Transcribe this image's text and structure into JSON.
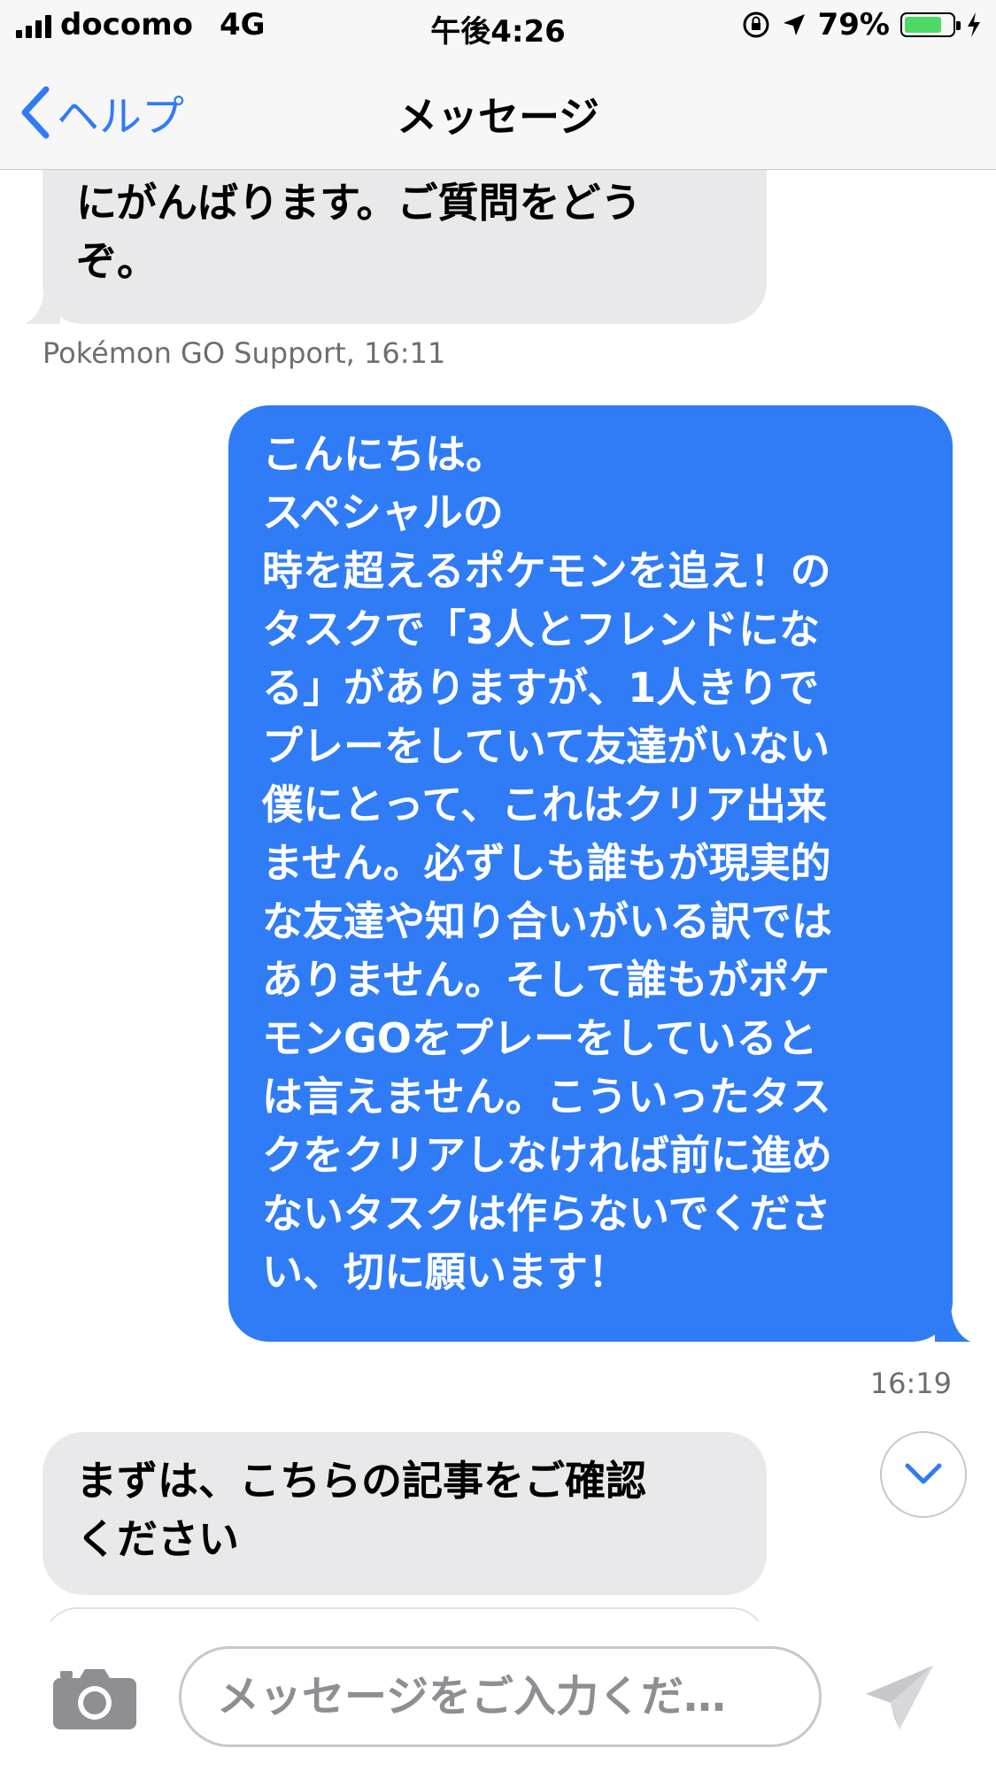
{
  "status_bar": {
    "carrier": "docomo",
    "network": "4G",
    "time": "午後4:26",
    "battery_percent": "79%",
    "battery_level": 0.79,
    "battery_color": "#4cd964"
  },
  "nav": {
    "back_label": "ヘルプ",
    "title": "メッセージ"
  },
  "messages": {
    "first_incoming": {
      "lines": [
        "にがんばります。ご質問をどう",
        "ぞ。"
      ],
      "sender_time": "Pokémon GO Support, 16:11"
    },
    "outgoing": {
      "lines": [
        "こんにちは。",
        "スペシャルの",
        "時を超えるポケモンを追え！の",
        "タスクで「3人とフレンドにな",
        "る」がありますが、1人きりで",
        "プレーをしていて友達がいない",
        "僕にとって、これはクリア出来",
        "ません。必ずしも誰もが現実的",
        "な友達や知り合いがいる訳では",
        "ありません。そして誰もがポケ",
        "モンGOをプレーをしていると",
        "は言えません。こういったタス",
        "クをクリアしなければ前に進め",
        "ないタスクは作らないでくださ",
        "い、切に願います！"
      ],
      "time": "16:19"
    },
    "second_incoming": {
      "lines": [
        "まずは、こちらの記事をご確認",
        "ください"
      ]
    }
  },
  "input": {
    "placeholder": "メッセージをご入力くだ…"
  },
  "icons": {
    "back": "chevron-left-icon",
    "scroll_down": "chevron-down-icon",
    "camera": "camera-icon",
    "send": "send-icon",
    "rotation_lock": "rotation-lock-icon",
    "location": "location-arrow-icon",
    "charging": "bolt-icon"
  },
  "colors": {
    "accent": "#2f7cf6",
    "incoming_bubble": "#e9e9eb",
    "outgoing_bubble": "#2f7cf6"
  }
}
